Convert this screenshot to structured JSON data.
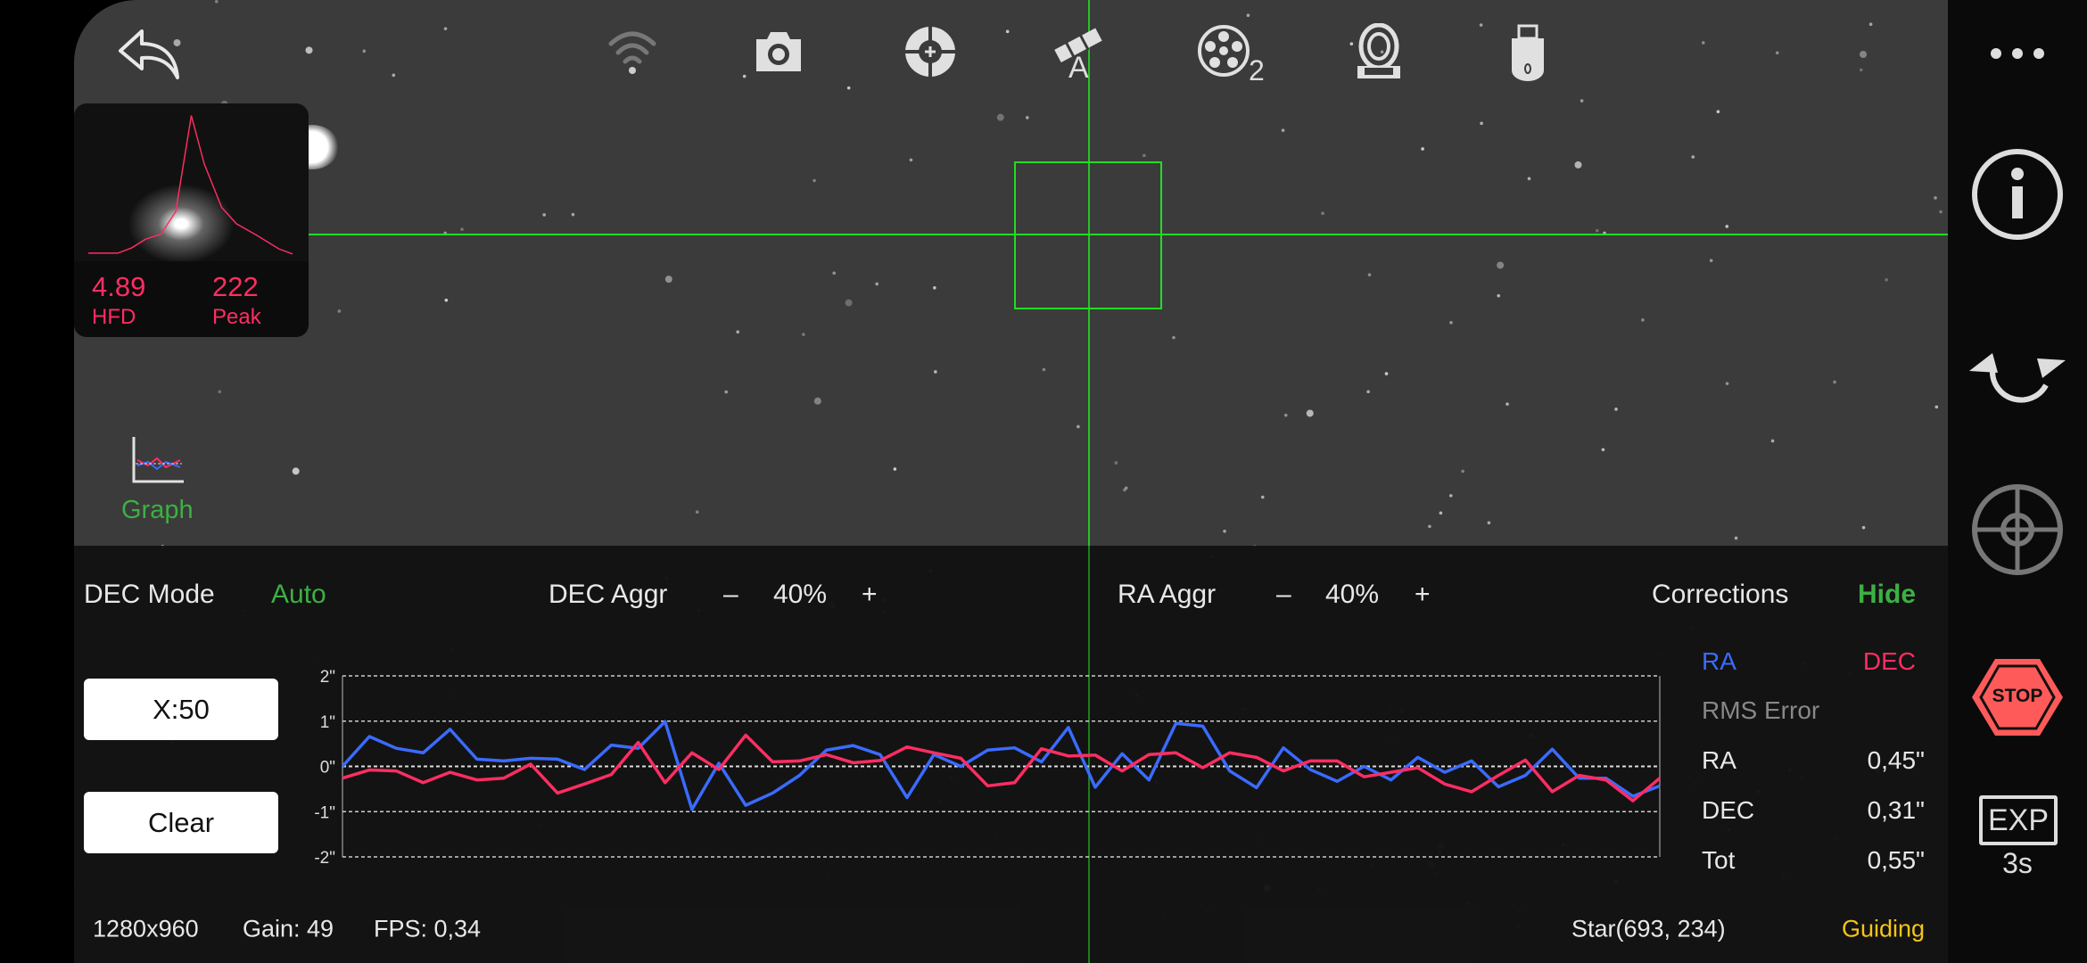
{
  "colors": {
    "accent_green": "#3cb043",
    "crosshair": "#22dd22",
    "ra": "#3a6bff",
    "dec": "#ff2d62",
    "guiding": "#f5c518",
    "stop": "#ff5a5a"
  },
  "toolbar": {
    "icons": [
      "back-icon",
      "wifi-icon",
      "camera-icon",
      "guide-icon",
      "telescope-icon",
      "filter-wheel-icon",
      "focuser-icon",
      "usb-icon"
    ],
    "telescope_badge": "A",
    "filter_wheel_badge": "2"
  },
  "hfd_panel": {
    "hfd_value": "4.89",
    "hfd_label": "HFD",
    "peak_value": "222",
    "peak_label": "Peak"
  },
  "graph_toggle": {
    "label": "Graph"
  },
  "controls": {
    "dec_mode_label": "DEC Mode",
    "dec_mode_value": "Auto",
    "dec_aggr_label": "DEC Aggr",
    "dec_aggr_value": "40%",
    "ra_aggr_label": "RA Aggr",
    "ra_aggr_value": "40%",
    "minus": "–",
    "plus": "+",
    "corrections_label": "Corrections",
    "corrections_value": "Hide"
  },
  "buttons": {
    "xscale": "X:50",
    "clear": "Clear"
  },
  "stats": {
    "ra_legend": "RA",
    "dec_legend": "DEC",
    "rms_title": "RMS Error",
    "ra_label": "RA",
    "ra_value": "0,45\"",
    "dec_label": "DEC",
    "dec_value": "0,31\"",
    "tot_label": "Tot",
    "tot_value": "0,55\""
  },
  "status": {
    "resolution": "1280x960",
    "gain": "Gain: 49",
    "fps": "FPS: 0,34",
    "star": "Star(693, 234)",
    "state": "Guiding"
  },
  "sidebar": {
    "icons": [
      "more-icon",
      "info-icon",
      "loop-icon",
      "target-icon",
      "stop-icon",
      "exposure-icon"
    ],
    "stop_label": "STOP",
    "exp_label": "EXP",
    "exp_value": "3s"
  },
  "chart_data": {
    "type": "line",
    "ylim": [
      -2,
      2
    ],
    "ytick_labels": [
      "2\"",
      "1\"",
      "0\"",
      "-1\"",
      "-2\""
    ],
    "yticks": [
      2,
      1,
      0,
      -1,
      -2
    ],
    "grid": true,
    "x_points": 50,
    "series": [
      {
        "name": "RA",
        "color": "#3a6bff",
        "values": [
          0,
          0.66,
          0.4,
          0.3,
          0.82,
          0.16,
          0.12,
          0.18,
          0.16,
          -0.07,
          0.47,
          0.4,
          0.99,
          -0.95,
          0.07,
          -0.86,
          -0.59,
          -0.2,
          0.36,
          0.46,
          0.26,
          -0.69,
          0.26,
          0,
          0.36,
          0.41,
          0.1,
          0.86,
          -0.46,
          0.28,
          -0.3,
          0.95,
          0.89,
          -0.1,
          -0.47,
          0.41,
          -0.07,
          -0.33,
          0,
          -0.3,
          0.2,
          -0.13,
          0.12,
          -0.45,
          -0.2,
          0.38,
          -0.26,
          -0.26,
          -0.66,
          -0.43
        ]
      },
      {
        "name": "DEC",
        "color": "#ff2d62",
        "values": [
          -0.26,
          -0.08,
          -0.1,
          -0.36,
          -0.13,
          -0.3,
          -0.26,
          0.05,
          -0.59,
          -0.39,
          -0.18,
          0.53,
          -0.36,
          0.3,
          -0.07,
          0.69,
          0.1,
          0.12,
          0.26,
          0.08,
          0.13,
          0.43,
          0.3,
          0.18,
          -0.43,
          -0.36,
          0.39,
          0.23,
          0.25,
          -0.1,
          0.26,
          0.3,
          -0.03,
          0.3,
          0.2,
          -0.1,
          0.12,
          0.12,
          -0.23,
          -0.13,
          -0.03,
          -0.39,
          -0.56,
          -0.2,
          0.14,
          -0.56,
          -0.2,
          -0.3,
          -0.76,
          -0.26
        ]
      }
    ]
  }
}
